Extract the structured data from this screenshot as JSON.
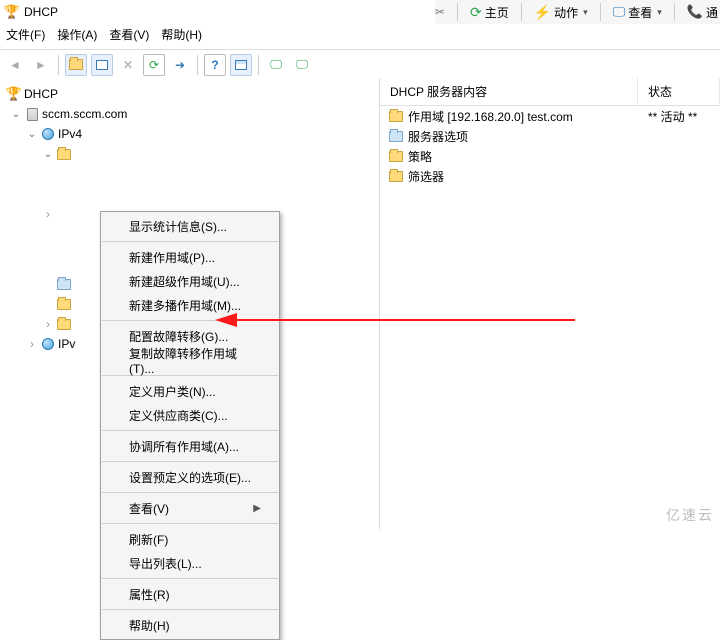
{
  "title": "DHCP",
  "menubar": {
    "file": "文件(F)",
    "action": "操作(A)",
    "view": "查看(V)",
    "help": "帮助(H)"
  },
  "ribbon": {
    "home": "主页",
    "actions": "动作",
    "view": "查看",
    "call": "通"
  },
  "tree": {
    "root": "DHCP",
    "server": "sccm.sccm.com",
    "ipv4": "IPv4",
    "ipv_partial": "IPv"
  },
  "context_menu": {
    "stats": "显示统计信息(S)...",
    "new_scope": "新建作用域(P)...",
    "new_superscope": "新建超级作用域(U)...",
    "new_multicast": "新建多播作用域(M)...",
    "cfg_failover": "配置故障转移(G)...",
    "copy_failover": "复制故障转移作用域(T)...",
    "user_classes": "定义用户类(N)...",
    "vendor_classes": "定义供应商类(C)...",
    "reconcile": "协调所有作用域(A)...",
    "set_predef": "设置预定义的选项(E)...",
    "view": "查看(V)",
    "refresh": "刷新(F)",
    "export": "导出列表(L)...",
    "properties": "属性(R)",
    "help": "帮助(H)"
  },
  "grid": {
    "header_name": "DHCP 服务器内容",
    "header_status": "状态",
    "rows": [
      {
        "label": "作用域 [192.168.20.0] test.com",
        "status": "** 活动 **",
        "icon": "folder"
      },
      {
        "label": "服务器选项",
        "status": "",
        "icon": "folder-blue"
      },
      {
        "label": "策略",
        "status": "",
        "icon": "folder"
      },
      {
        "label": "筛选器",
        "status": "",
        "icon": "folder"
      }
    ]
  },
  "watermark": "亿速云"
}
